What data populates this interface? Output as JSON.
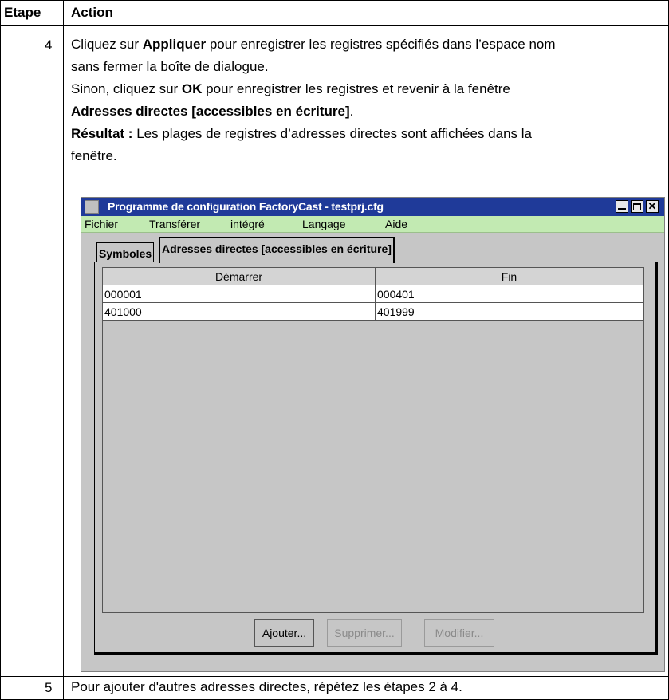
{
  "table": {
    "header_step": "Etape",
    "header_action": "Action",
    "rows": [
      {
        "step": "4",
        "lines": [
          {
            "a": "Cliquez sur ",
            "b": "Appliquer",
            "c": " pour enregistrer les registres spécifiés dans l’espace nom"
          },
          {
            "a": "sans fermer la boîte de dialogue."
          },
          {
            "a": "Sinon, cliquez sur ",
            "b": "OK",
            "c": " pour enregistrer les registres et revenir à la fenêtre"
          },
          {
            "b": "Adresses directes [accessibles en écriture]",
            "c": "."
          },
          {
            "b": "Résultat :",
            "c": " Les plages de registres d’adresses directes sont affichées dans la"
          },
          {
            "a": "fenêtre."
          }
        ]
      },
      {
        "step": "5",
        "text": "Pour ajouter d'autres adresses directes, répétez les étapes 2 à 4."
      }
    ]
  },
  "dialog": {
    "title": "Programme de configuration FactoryCast  - testprj.cfg",
    "menu": [
      "Fichier",
      "Transférer",
      "intégré",
      "Langage",
      "Aide"
    ],
    "tabs": [
      "Symboles",
      "Adresses directes [accessibles en écriture]"
    ],
    "columns": [
      "Démarrer",
      "Fin"
    ],
    "rows": [
      [
        "000001",
        "000401"
      ],
      [
        "401000",
        "401999"
      ]
    ],
    "buttons": {
      "add": "Ajouter...",
      "delete": "Supprimer...",
      "modify": "Modifier..."
    }
  }
}
